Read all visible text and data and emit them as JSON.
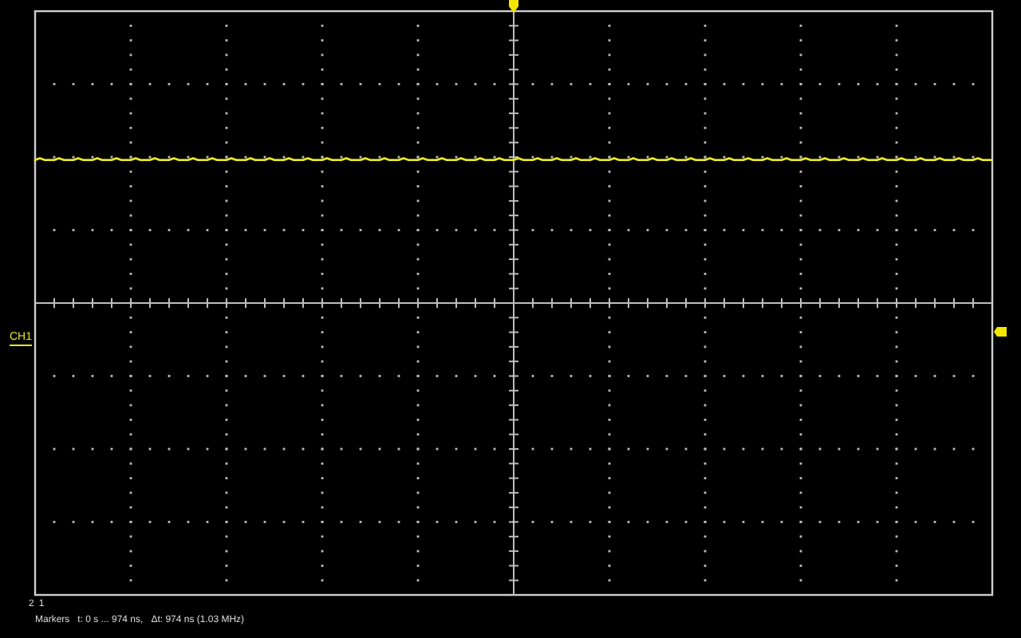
{
  "channel_label": "CH1",
  "reference_labels": [
    "2",
    "1"
  ],
  "markers_readout": "Markers   t: 0 s ... 974 ns,   Δt: 974 ns (1.03 MHz)"
}
